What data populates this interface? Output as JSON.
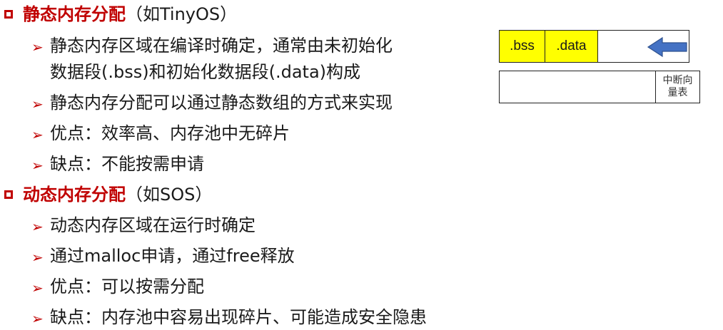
{
  "static_section": {
    "title": "静态内存分配",
    "title_suffix": "（如TinyOS）",
    "bullets": [
      "静态内存区域在编译时确定，通常由未初始化",
      "数据段(.bss)和初始化数据段(.data)构成",
      "静态内存分配可以通过静态数组的方式来实现",
      "优点：效率高、内存池中无碎片",
      "缺点：不能按需申请"
    ]
  },
  "dynamic_section": {
    "title": "动态内存分配",
    "title_suffix": "（如SOS）",
    "bullets": [
      "动态内存区域在运行时确定",
      "通过malloc申请，通过free释放",
      "优点：可以按需分配",
      "缺点：内存池中容易出现碎片、可能造成安全隐患"
    ]
  },
  "diagram": {
    "segments": [
      ".bss",
      ".data"
    ],
    "vector_table_label_line1": "中断向",
    "vector_table_label_line2": "量表",
    "arrow_direction": "left",
    "colors": {
      "segment_fill": "#ffff00",
      "arrow_fill": "#4472c4",
      "arrow_stroke": "#2f528f"
    }
  },
  "colors": {
    "title": "#c00000",
    "bullet_arrow": "#c00000",
    "text": "#1a1a1a"
  }
}
